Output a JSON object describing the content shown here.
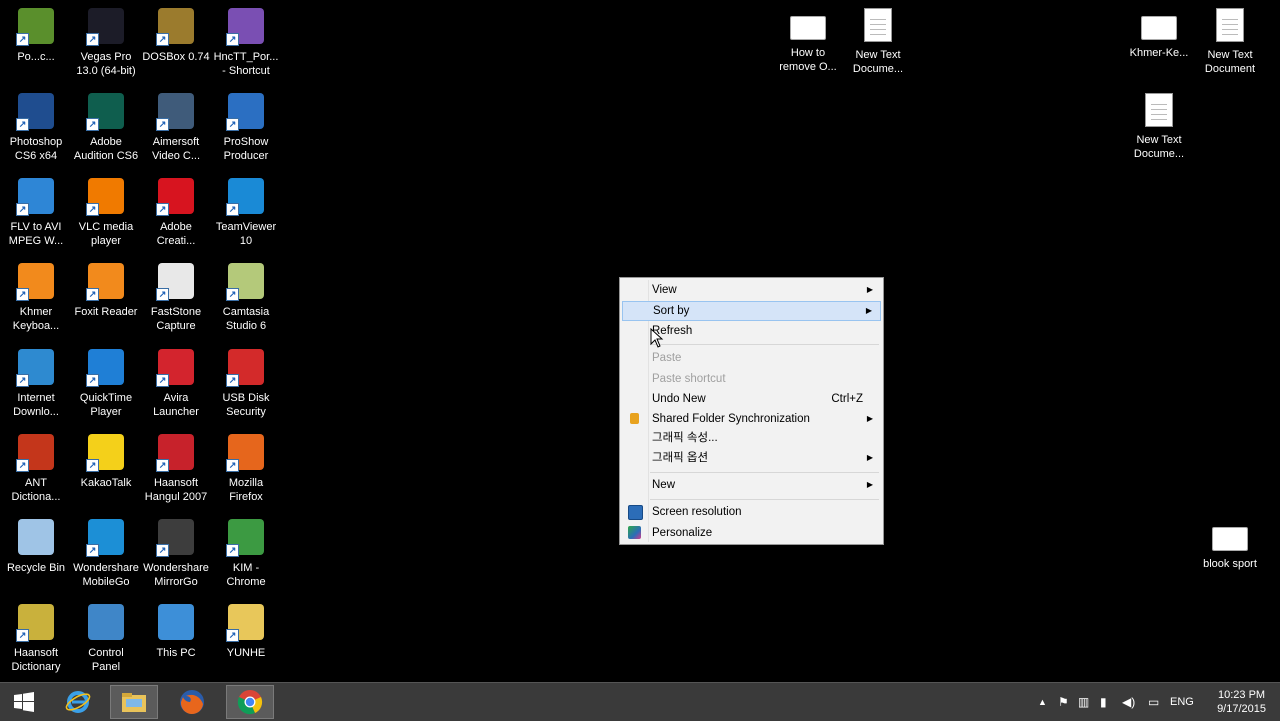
{
  "desktop": {
    "icons_left": [
      {
        "label": "Po...c...",
        "icon": "poweriso-icon",
        "color": "#5a8f2c"
      },
      {
        "label": "Vegas Pro\n13.0 (64-bit)",
        "icon": "vegas-icon",
        "color": "#1c1c28"
      },
      {
        "label": "DOSBox 0.74",
        "icon": "dosbox-icon",
        "color": "#9b7b2d"
      },
      {
        "label": "HncTT_Por...\n- Shortcut",
        "icon": "hnctt-icon",
        "color": "#7a4fb3"
      },
      {
        "label": "Photoshop\nCS6 x64",
        "icon": "photoshop-icon",
        "color": "#1f4d8f"
      },
      {
        "label": "Adobe\nAudition CS6",
        "icon": "audition-icon",
        "color": "#0f5e4e"
      },
      {
        "label": "Aimersoft\nVideo C...",
        "icon": "aimersoft-icon",
        "color": "#3f5b7a"
      },
      {
        "label": "ProShow\nProducer",
        "icon": "proshow-icon",
        "color": "#2b6fc2"
      },
      {
        "label": "FLV to AVI\nMPEG W...",
        "icon": "flv-icon",
        "color": "#2e86d6"
      },
      {
        "label": "VLC media\nplayer",
        "icon": "vlc-icon",
        "color": "#f07a00"
      },
      {
        "label": "Adobe\nCreati...",
        "icon": "creative-cloud-icon",
        "color": "#d7141f"
      },
      {
        "label": "TeamViewer\n10",
        "icon": "teamviewer-icon",
        "color": "#1a8ad6"
      },
      {
        "label": "Khmer\nKeyboa...",
        "icon": "pdf-icon",
        "color": "#f28a1c"
      },
      {
        "label": "Foxit Reader",
        "icon": "foxit-icon",
        "color": "#f28a1c"
      },
      {
        "label": "FastStone\nCapture",
        "icon": "faststone-icon",
        "color": "#e8e8e8"
      },
      {
        "label": "Camtasia\nStudio 6",
        "icon": "camtasia-icon",
        "color": "#b4c97a"
      },
      {
        "label": "Internet\nDownlo...",
        "icon": "idm-icon",
        "color": "#2e8ad0"
      },
      {
        "label": "QuickTime\nPlayer",
        "icon": "quicktime-icon",
        "color": "#1f7fd6"
      },
      {
        "label": "Avira\nLauncher",
        "icon": "avira-icon",
        "color": "#d3242d"
      },
      {
        "label": "USB Disk\nSecurity",
        "icon": "usb-security-icon",
        "color": "#d32a2a"
      },
      {
        "label": "ANT\nDictiona...",
        "icon": "ant-dictionary-icon",
        "color": "#c4361b"
      },
      {
        "label": "KakaoTalk",
        "icon": "kakaotalk-icon",
        "color": "#f4d01a"
      },
      {
        "label": "Haansoft\nHangul 2007",
        "icon": "hangul-icon",
        "color": "#c7222b"
      },
      {
        "label": "Mozilla\nFirefox",
        "icon": "firefox-icon",
        "color": "#e6661c"
      },
      {
        "label": "Recycle Bin",
        "icon": "recycle-bin-icon",
        "color": "#9fc4e6"
      },
      {
        "label": "Wondershare\nMobileGo",
        "icon": "mobilego-icon",
        "color": "#1c8fd6"
      },
      {
        "label": "Wondershare\nMirrorGo",
        "icon": "mirrorgo-icon",
        "color": "#3d3d3d"
      },
      {
        "label": "KIM -\nChrome",
        "icon": "chrome-icon",
        "color": "#3c9a42"
      },
      {
        "label": "Haansoft\nDictionary",
        "icon": "haansoft-dictionary-icon",
        "color": "#c9b13c"
      },
      {
        "label": "Control\nPanel",
        "icon": "control-panel-icon",
        "color": "#3f86c8"
      },
      {
        "label": "This PC",
        "icon": "this-pc-icon",
        "color": "#3d8fd8"
      },
      {
        "label": "YUNHE",
        "icon": "folder-icon",
        "color": "#e8c75a"
      }
    ],
    "icons_right": [
      {
        "label": "How to\nremove O...",
        "icon": "document-wide-icon"
      },
      {
        "label": "New Text\nDocume...",
        "icon": "text-document-icon"
      },
      {
        "label": "Khmer-Ke...",
        "icon": "keyboard-image-icon"
      },
      {
        "label": "New Text\nDocument",
        "icon": "text-document-icon"
      },
      {
        "label": "New Text\nDocume...",
        "icon": "text-document-icon"
      },
      {
        "label": "blook sport",
        "icon": "document-wide-icon"
      }
    ]
  },
  "context_menu": {
    "items": [
      {
        "label": "View",
        "submenu": true
      },
      {
        "label": "Sort by",
        "submenu": true,
        "highlighted": true
      },
      {
        "label": "Refresh"
      },
      {
        "label": "Paste",
        "disabled": true
      },
      {
        "label": "Paste shortcut",
        "disabled": true
      },
      {
        "label": "Undo New",
        "shortcut": "Ctrl+Z"
      },
      {
        "label": "Shared Folder Synchronization",
        "submenu": true,
        "icon": "sync-icon"
      },
      {
        "label": "그래픽 속성..."
      },
      {
        "label": "그래픽 옵션",
        "submenu": true
      },
      {
        "label": "New",
        "submenu": true
      },
      {
        "label": "Screen resolution",
        "icon": "screen-resolution-icon"
      },
      {
        "label": "Personalize",
        "icon": "personalize-icon"
      }
    ]
  },
  "taskbar": {
    "apps": [
      "start-icon",
      "internet-explorer-icon",
      "file-explorer-icon",
      "firefox-icon",
      "chrome-icon"
    ],
    "tray": {
      "language": "ENG",
      "time": "10:23 PM",
      "date": "9/17/2015"
    }
  }
}
